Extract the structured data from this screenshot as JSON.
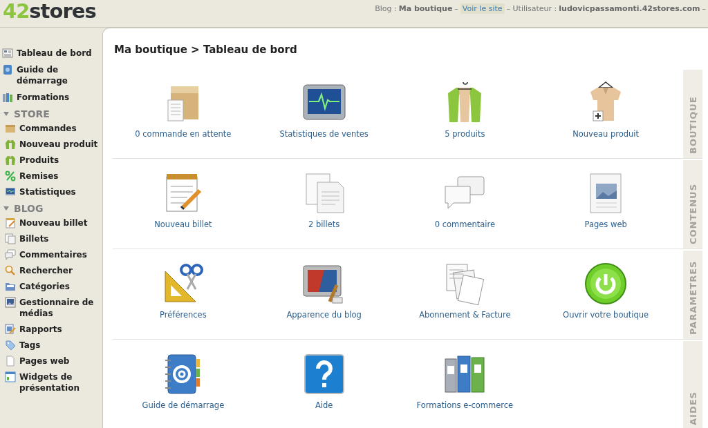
{
  "logo": {
    "accent": "42",
    "name": "stores"
  },
  "header": {
    "blog_label": "Blog :",
    "blog_name": "Ma boutique",
    "separator": "–",
    "view_site_link": "Voir le site",
    "user_label": "– Utilisateur :",
    "user_name": "ludovicpassamonti.42stores.com",
    "separator_end": "–"
  },
  "sidebar": {
    "top_items": [
      {
        "label": "Tableau de bord",
        "kind": "dashboard"
      },
      {
        "label": "Guide de démarrage",
        "kind": "guide"
      },
      {
        "label": "Formations",
        "kind": "formations"
      }
    ],
    "groups": [
      {
        "title": "STORE",
        "expanded": true,
        "items": [
          {
            "label": "Commandes",
            "kind": "box"
          },
          {
            "label": "Nouveau produit",
            "kind": "shirt"
          },
          {
            "label": "Produits",
            "kind": "shirt"
          },
          {
            "label": "Remises",
            "kind": "percent"
          },
          {
            "label": "Statistiques",
            "kind": "stats"
          }
        ]
      },
      {
        "title": "BLOG",
        "expanded": true,
        "items": [
          {
            "label": "Nouveau billet",
            "kind": "notepad"
          },
          {
            "label": "Billets",
            "kind": "pages"
          },
          {
            "label": "Commentaires",
            "kind": "bubbles"
          },
          {
            "label": "Rechercher",
            "kind": "search"
          },
          {
            "label": "Catégories",
            "kind": "folder"
          },
          {
            "label": "Gestionnaire de médias",
            "kind": "media"
          },
          {
            "label": "Rapports",
            "kind": "reports"
          },
          {
            "label": "Tags",
            "kind": "tag"
          },
          {
            "label": "Pages web",
            "kind": "page"
          },
          {
            "label": "Widgets de présentation",
            "kind": "widget"
          }
        ]
      }
    ]
  },
  "page_title": "Ma boutique > Tableau de bord",
  "sections": [
    {
      "tab": "BOUTIQUE",
      "tiles": [
        {
          "label": "0 commande en attente",
          "kind": "box"
        },
        {
          "label": "Statistiques de ventes",
          "kind": "monitor"
        },
        {
          "label": "5 produits",
          "kind": "shirts"
        },
        {
          "label": "Nouveau produit",
          "kind": "shirtplus"
        }
      ]
    },
    {
      "tab": "CONTENUS",
      "tiles": [
        {
          "label": "Nouveau billet",
          "kind": "notepad"
        },
        {
          "label": "2 billets",
          "kind": "pages"
        },
        {
          "label": "0 commentaire",
          "kind": "bubbles"
        },
        {
          "label": "Pages web",
          "kind": "webpage"
        }
      ]
    },
    {
      "tab": "PARAMETRES",
      "tiles": [
        {
          "label": "Préférences",
          "kind": "tools"
        },
        {
          "label": "Apparence du blog",
          "kind": "paint"
        },
        {
          "label": "Abonnement & Facture",
          "kind": "docs"
        },
        {
          "label": "Ouvrir votre boutique",
          "kind": "power"
        }
      ]
    },
    {
      "tab": "AIDES",
      "tiles": [
        {
          "label": "Guide de démarrage",
          "kind": "addressbook"
        },
        {
          "label": "Aide",
          "kind": "question"
        },
        {
          "label": "Formations e-commerce",
          "kind": "binders"
        }
      ]
    }
  ]
}
